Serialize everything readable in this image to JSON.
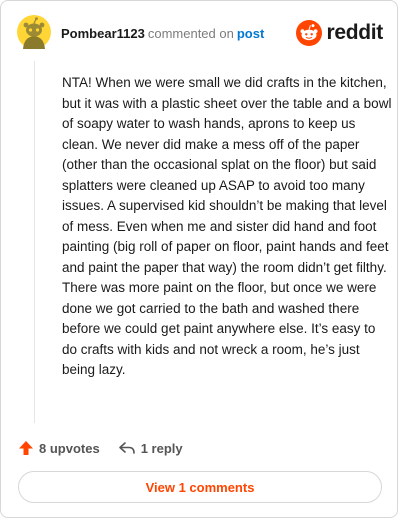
{
  "header": {
    "username": "Pombear1123",
    "action_text": "commented on",
    "post_link": "post",
    "brand_word": "reddit"
  },
  "comment": {
    "body": "NTA! When we were small we did crafts in the kitchen, but it was with a plastic sheet over the table and a bowl of soapy water to wash hands, aprons to keep us clean. We never did make a mess off of the paper (other than the occasional splat on the floor) but said splatters were cleaned up ASAP to avoid too many issues. A supervised kid shouldn’t be making that level of mess. Even when me and sister did hand and foot painting (big roll of paper on floor, paint hands and feet and paint the paper that way) the room didn’t get filthy. There was more paint on the floor, but once we were done we got carried to the bath and washed there before we could get paint anywhere else. It’s easy to do crafts with kids and not wreck a room, he’s just being lazy."
  },
  "actions": {
    "upvotes_label": "8 upvotes",
    "reply_label": "1 reply",
    "view_comments_label": "View 1 comments"
  },
  "icons": {
    "avatar": "snoo-avatar-icon",
    "brand": "reddit-logo-icon",
    "upvote": "upvote-arrow-icon",
    "reply": "reply-arrow-icon"
  },
  "colors": {
    "accent": "#ff4500",
    "link": "#0079d3",
    "avatar_bg": "#ffd635"
  }
}
